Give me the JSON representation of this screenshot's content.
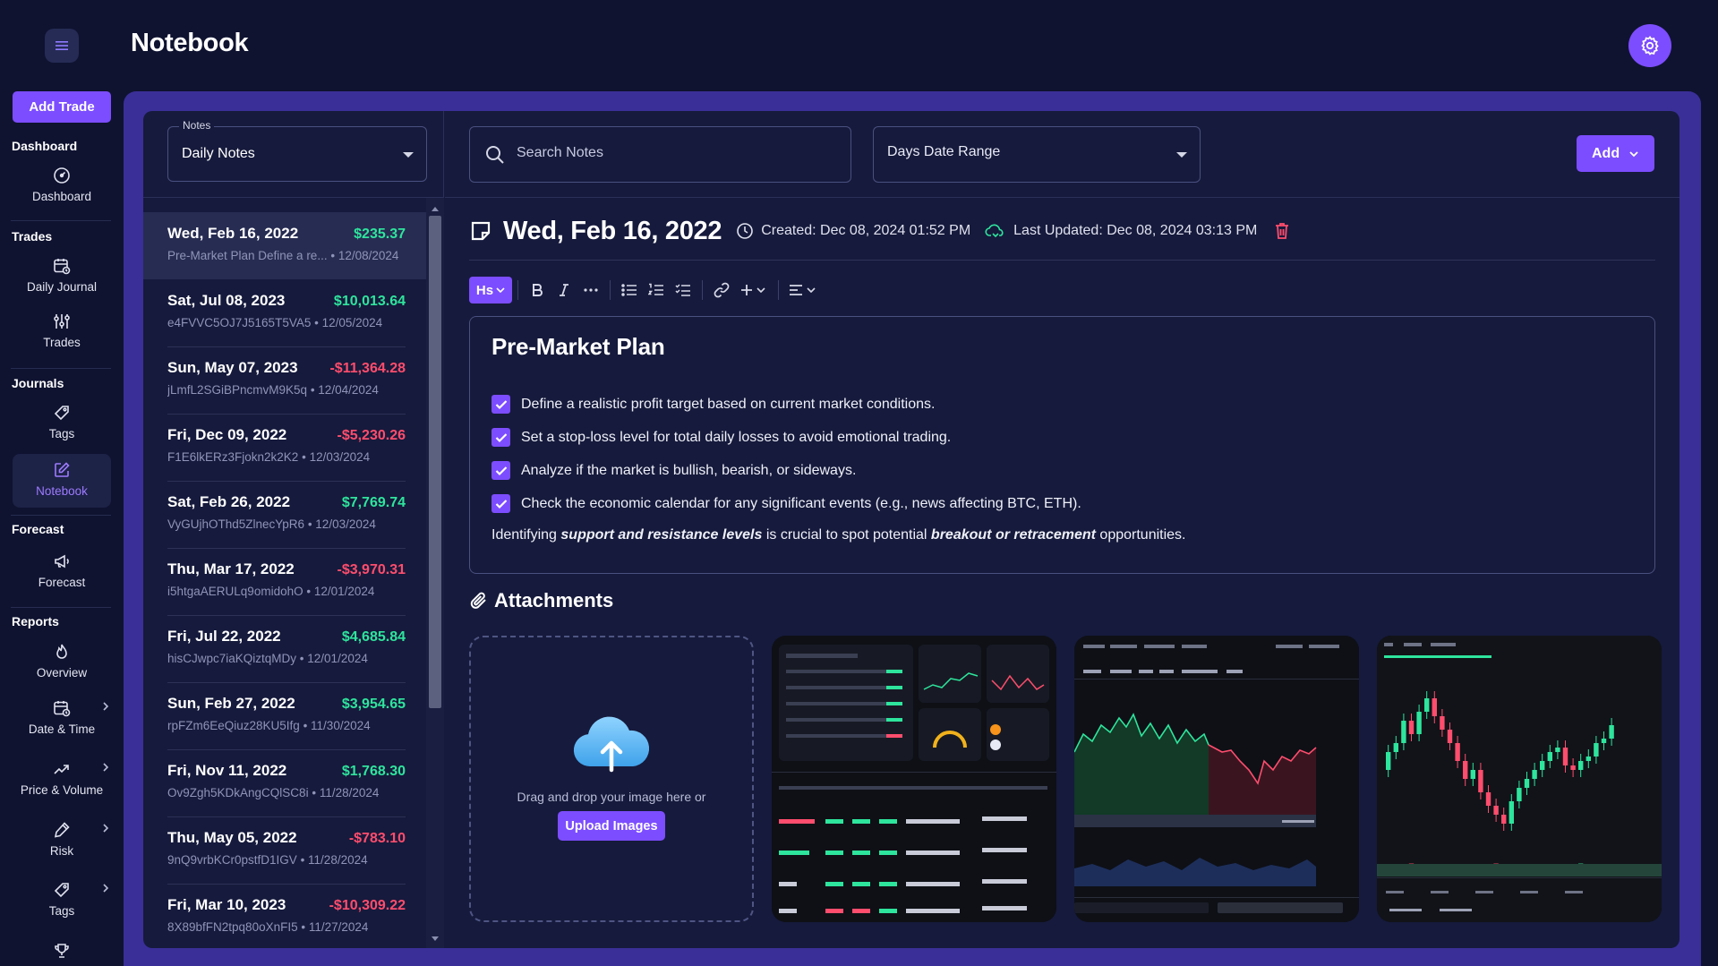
{
  "header": {
    "title": "Notebook"
  },
  "sidebar": {
    "add_trade": "Add Trade",
    "sections": {
      "dashboard": "Dashboard",
      "trades": "Trades",
      "journals": "Journals",
      "forecast": "Forecast",
      "reports": "Reports"
    },
    "items": {
      "dashboard": "Dashboard",
      "daily_journal": "Daily Journal",
      "trades": "Trades",
      "tags": "Tags",
      "notebook": "Notebook",
      "forecast": "Forecast",
      "overview": "Overview",
      "date_time": "Date & Time",
      "price_volume": "Price & Volume",
      "risk": "Risk",
      "report_tags": "Tags"
    },
    "active": "notebook"
  },
  "notes_select": {
    "legend": "Notes",
    "value": "Daily Notes"
  },
  "search": {
    "placeholder": "Search Notes"
  },
  "range_select": {
    "value": "Days Date Range"
  },
  "add_button": "Add",
  "notes": [
    {
      "date": "Wed, Feb 16, 2022",
      "amount": "$235.37",
      "sign": "pos",
      "preview": "Pre-Market Plan Define a re...",
      "created": "12/08/2024"
    },
    {
      "date": "Sat, Jul 08, 2023",
      "amount": "$10,013.64",
      "sign": "pos",
      "preview": "e4FVVC5OJ7J5165T5VA5",
      "created": "12/05/2024"
    },
    {
      "date": "Sun, May 07, 2023",
      "amount": "-$11,364.28",
      "sign": "neg",
      "preview": "jLmfL2SGiBPncmvM9K5q",
      "created": "12/04/2024"
    },
    {
      "date": "Fri, Dec 09, 2022",
      "amount": "-$5,230.26",
      "sign": "neg",
      "preview": "F1E6lkERz3Fjokn2k2K2",
      "created": "12/03/2024"
    },
    {
      "date": "Sat, Feb 26, 2022",
      "amount": "$7,769.74",
      "sign": "pos",
      "preview": "VyGUjhOThd5ZlnecYpR6",
      "created": "12/03/2024"
    },
    {
      "date": "Thu, Mar 17, 2022",
      "amount": "-$3,970.31",
      "sign": "neg",
      "preview": "i5htgaAERULq9omidohO",
      "created": "12/01/2024"
    },
    {
      "date": "Fri, Jul 22, 2022",
      "amount": "$4,685.84",
      "sign": "pos",
      "preview": "hisCJwpc7iaKQiztqMDy",
      "created": "12/01/2024"
    },
    {
      "date": "Sun, Feb 27, 2022",
      "amount": "$3,954.65",
      "sign": "pos",
      "preview": "rpFZm6EeQiuz28KU5Ifg",
      "created": "11/30/2024"
    },
    {
      "date": "Fri, Nov 11, 2022",
      "amount": "$1,768.30",
      "sign": "pos",
      "preview": "Ov9Zgh5KDkAngCQlSC8i",
      "created": "11/28/2024"
    },
    {
      "date": "Thu, May 05, 2022",
      "amount": "-$783.10",
      "sign": "neg",
      "preview": "9nQ9vrbKCr0pstfD1IGV",
      "created": "11/28/2024"
    },
    {
      "date": "Fri, Mar 10, 2023",
      "amount": "-$10,309.22",
      "sign": "neg",
      "preview": "8X89bfFN2tpq80oXnFI5",
      "created": "11/27/2024"
    }
  ],
  "note": {
    "title": "Wed, Feb 16, 2022",
    "created": "Created: Dec 08, 2024 01:52 PM",
    "updated": "Last Updated: Dec 08, 2024 03:13 PM",
    "toolbar_heading": "Hs",
    "heading": "Pre-Market Plan",
    "checklist": [
      "Define a realistic profit target based on current market conditions.",
      "Set a stop-loss level for total daily losses to avoid emotional trading.",
      "Analyze if the market is bullish, bearish, or sideways.",
      "Check the economic calendar for any significant events (e.g., news affecting BTC, ETH)."
    ],
    "paragraph": {
      "p1": "Identifying ",
      "em1": "support and resistance levels",
      "p2": " is crucial to spot potential ",
      "em2": "breakout or retracement",
      "p3": " opportunities."
    }
  },
  "attachments": {
    "title": "Attachments",
    "drop_text": "Drag and drop your image here or",
    "upload_label": "Upload Images"
  },
  "colors": {
    "accent": "#7c4dff",
    "positive": "#2ee59d",
    "negative": "#ff4d6d",
    "panel": "#161a3c",
    "background": "#0f1330"
  }
}
